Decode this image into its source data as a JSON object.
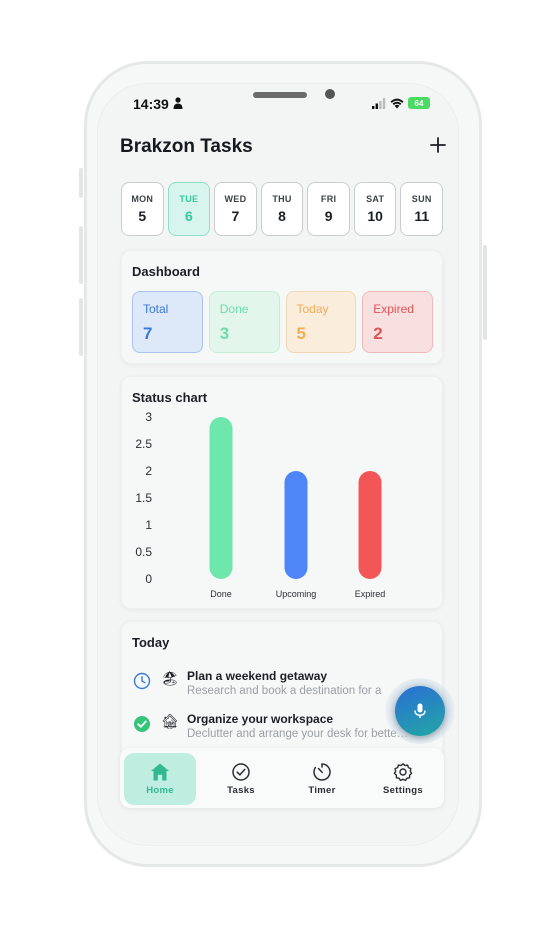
{
  "status_bar": {
    "time": "14:39",
    "battery": "64"
  },
  "header": {
    "title": "Brakzon Tasks",
    "add_label": "+"
  },
  "week": [
    {
      "day": "MON",
      "date": "5",
      "active": false
    },
    {
      "day": "TUE",
      "date": "6",
      "active": true
    },
    {
      "day": "WED",
      "date": "7",
      "active": false
    },
    {
      "day": "THU",
      "date": "8",
      "active": false
    },
    {
      "day": "FRI",
      "date": "9",
      "active": false
    },
    {
      "day": "SAT",
      "date": "10",
      "active": false
    },
    {
      "day": "SUN",
      "date": "11",
      "active": false
    }
  ],
  "dashboard": {
    "title": "Dashboard",
    "stats": [
      {
        "label": "Total",
        "value": "7"
      },
      {
        "label": "Done",
        "value": "3"
      },
      {
        "label": "Today",
        "value": "5"
      },
      {
        "label": "Expired",
        "value": "2"
      }
    ]
  },
  "status_chart": {
    "title": "Status chart"
  },
  "chart_data": {
    "type": "bar",
    "title": "Status chart",
    "categories": [
      "Done",
      "Upcoming",
      "Expired"
    ],
    "values": [
      3,
      2,
      2
    ],
    "colors": [
      "#6ee7ad",
      "#4f86f7",
      "#f25656"
    ],
    "yticks": [
      "3",
      "2.5",
      "2",
      "1.5",
      "1",
      "0.5",
      "0"
    ],
    "ylim": [
      0,
      3
    ],
    "grid": false
  },
  "today": {
    "title": "Today",
    "tasks": [
      {
        "title": "Plan a weekend getaway",
        "desc": "Research and book a destination for a",
        "emoji": "🏖",
        "done": false
      },
      {
        "title": "Organize your workspace",
        "desc": "Declutter and arrange your desk for bette…",
        "emoji": "🏚",
        "done": true
      }
    ]
  },
  "nav": {
    "items": [
      {
        "label": "Home",
        "icon": "home-icon",
        "active": true
      },
      {
        "label": "Tasks",
        "icon": "check-circle-icon",
        "active": false
      },
      {
        "label": "Timer",
        "icon": "timer-icon",
        "active": false
      },
      {
        "label": "Settings",
        "icon": "settings-icon",
        "active": false
      }
    ]
  },
  "fab": {
    "icon": "mic-icon"
  },
  "colors": {
    "accent": "#37c79b",
    "accent_bg": "#d7f5ec"
  }
}
